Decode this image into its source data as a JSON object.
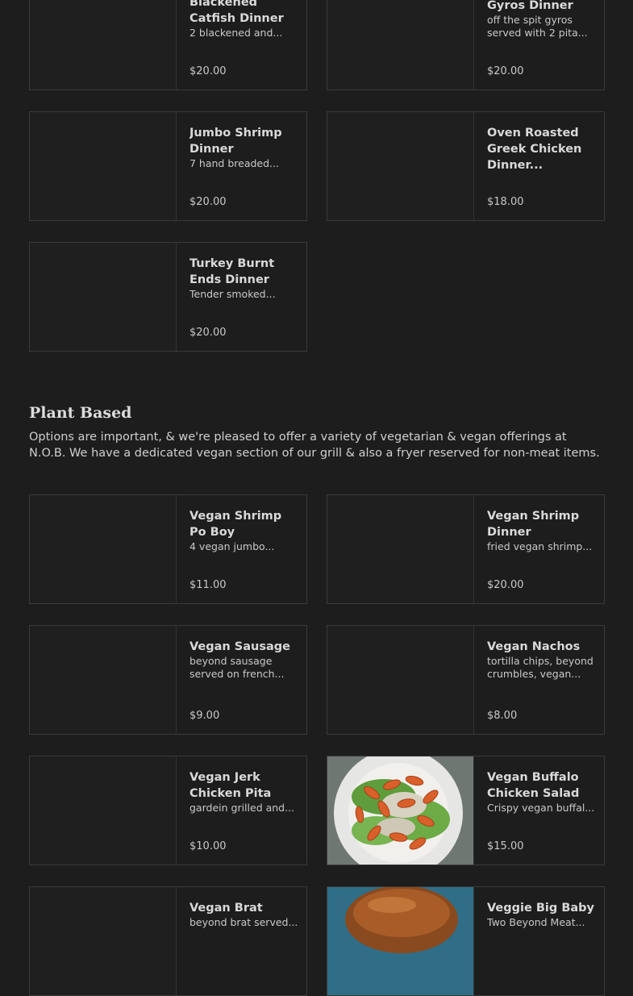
{
  "section": {
    "title": "Plant Based",
    "description": "Options are important, & we're pleased to offer a variety of vegetarian & vegan offerings at N.O.B. We have a dedicated vegan section of our grill & also a fryer reserved for non-meat items."
  },
  "items": [
    {
      "name": "Blackened Catfish Dinner",
      "desc": "2 blackened and...",
      "price": "$20.00"
    },
    {
      "name": "Gyros Dinner",
      "desc": "off the spit gyros served with 2 pita...",
      "price": "$20.00"
    },
    {
      "name": "Jumbo Shrimp Dinner",
      "desc": "7 hand breaded...",
      "price": "$20.00"
    },
    {
      "name": "Oven Roasted Greek Chicken Dinner...",
      "desc": "",
      "price": "$18.00"
    },
    {
      "name": "Turkey Burnt Ends Dinner",
      "desc": "Tender smoked...",
      "price": "$20.00"
    },
    {
      "name": "Vegan Shrimp Po Boy",
      "desc": "4 vegan jumbo...",
      "price": "$11.00"
    },
    {
      "name": "Vegan Shrimp Dinner",
      "desc": "fried vegan shrimp...",
      "price": "$20.00"
    },
    {
      "name": "Vegan Sausage",
      "desc": "beyond sausage served on french...",
      "price": "$9.00"
    },
    {
      "name": "Vegan Nachos",
      "desc": "tortilla chips, beyond crumbles, vegan...",
      "price": "$8.00"
    },
    {
      "name": "Vegan Jerk Chicken Pita",
      "desc": "gardein grilled and...",
      "price": "$10.00"
    },
    {
      "name": "Vegan Buffalo Chicken Salad",
      "desc": "Crispy vegan buffal...",
      "price": "$15.00"
    },
    {
      "name": "Vegan Brat",
      "desc": "beyond brat served...",
      "price": ""
    },
    {
      "name": "Veggie Big Baby",
      "desc": "Two Beyond Meat...",
      "price": ""
    }
  ]
}
